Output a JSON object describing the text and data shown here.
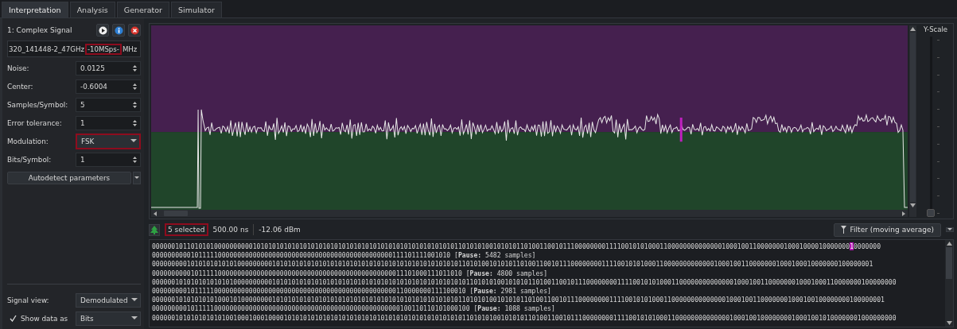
{
  "tabs": [
    {
      "label": "Interpretation",
      "selected": true
    },
    {
      "label": "Analysis",
      "selected": false
    },
    {
      "label": "Generator",
      "selected": false
    },
    {
      "label": "Simulator",
      "selected": false
    }
  ],
  "signal": {
    "title": "1: Complex Signal",
    "filename": [
      {
        "text": "320_141448-2_47GHz",
        "highlighted": false
      },
      {
        "text": "-10MSps-",
        "highlighted": true
      },
      {
        "text": "MHz",
        "highlighted": false
      }
    ]
  },
  "parameters": [
    {
      "label": "Noise:",
      "value": "0.0125",
      "kind": "spin",
      "highlighted": false
    },
    {
      "label": "Center:",
      "value": "-0.6004",
      "kind": "spin",
      "highlighted": false
    },
    {
      "label": "Samples/Symbol:",
      "value": "5",
      "kind": "spin",
      "highlighted": false
    },
    {
      "label": "Error tolerance:",
      "value": "1",
      "kind": "spin",
      "highlighted": false
    },
    {
      "label": "Modulation:",
      "value": "FSK",
      "kind": "combo",
      "highlighted": true
    },
    {
      "label": "Bits/Symbol:",
      "value": "1",
      "kind": "spin",
      "highlighted": false
    }
  ],
  "autodetect_button": "Autodetect parameters",
  "signal_view": {
    "label": "Signal view:",
    "value": "Demodulated"
  },
  "show_data": {
    "label": "Show data as",
    "checked": true,
    "value": "Bits"
  },
  "y_scale": {
    "label": "Y-Scale",
    "level": 0
  },
  "status": {
    "selection": "5 selected",
    "highlighted": true,
    "duration": "500.00 ns",
    "power": "-12.06 dBm",
    "filter_button": "Filter (moving average)"
  },
  "bits": [
    {
      "parts": [
        {
          "text": "000000101101010100000000001010101010101010101010101010101010101010101010101010110101010010101011010011001011100000000111100101010001100000000000000100010011000000010001000010000000",
          "selected": false
        },
        {
          "text": "1",
          "selected": true
        },
        {
          "text": "0000000",
          "selected": false
        }
      ]
    },
    {
      "parts": [
        {
          "text": "00000000001011111000000000000000000000000000000000000000000000111101111001010 [**Pause:** 5482 samples]",
          "selected": false
        }
      ]
    },
    {
      "parts": [
        {
          "text": "000000000101010101010100000000010101010101010101010101010101010101010101010101011010100101010110100110010111000000001111001010100011000000000000010001001100000001000100010000000100000001",
          "selected": false
        }
      ]
    },
    {
      "parts": [
        {
          "text": "00000000001011111000000000000000000000000000000000000000000000011101000111011010 [**Pause:** 4800 samples]",
          "selected": false
        }
      ]
    },
    {
      "parts": [
        {
          "text": "000000101010101010101000000000010101010101010101010101010101010101010101010101010110101010010101011010011001011100000000111100101010001100000000000000100010011000000010001000110000000100000000",
          "selected": false
        }
      ]
    },
    {
      "parts": [
        {
          "text": "000000000101111100000000000000000000000000000000000000000000000110000000111100010 [**Pause:** 2981 samples]",
          "selected": false
        }
      ]
    },
    {
      "parts": [
        {
          "text": "000000101010101010001010000000010101010101010101010101010101010101010101010101011010101001010101101001100101110000000011110010101000110000000000000010001001100000001000100100000000100000001",
          "selected": false
        }
      ]
    },
    {
      "parts": [
        {
          "text": "0000000001011111000000000000000000000000000000000000000000000000100110110101000100 [**Pause:** 1088 samples]",
          "selected": false
        }
      ]
    },
    {
      "parts": [
        {
          "text": "000000101010101010100100010001000010101010101010101010101010101010101010101010101101010100101010110100110010111000000001111001010100011000000000000001000100100000000100010010100000001000000000",
          "selected": false
        }
      ]
    }
  ]
}
